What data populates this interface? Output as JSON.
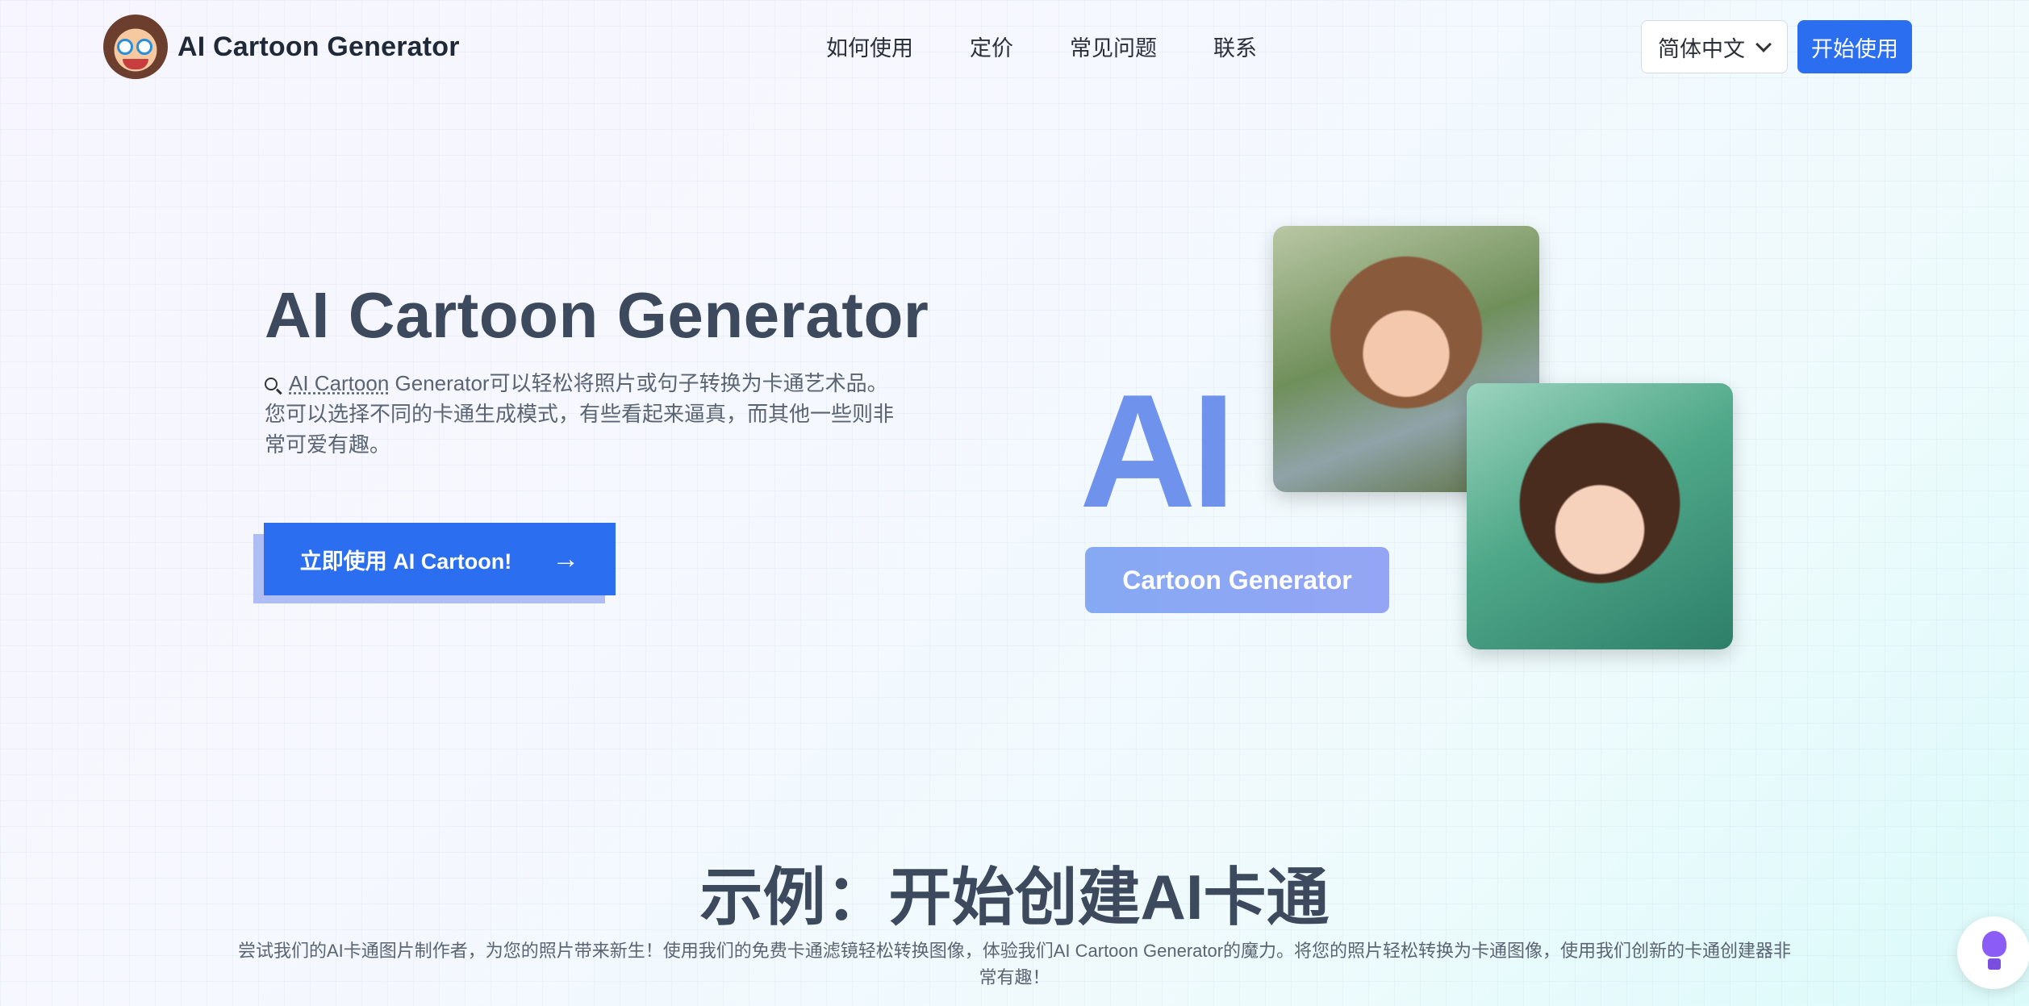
{
  "header": {
    "brand_name": "AI Cartoon Generator",
    "nav": [
      "如何使用",
      "定价",
      "常见问题",
      "联系"
    ],
    "language": "简体中文",
    "start_label": "开始使用"
  },
  "hero": {
    "title": "AI Cartoon Generator",
    "desc_link": "AI Cartoon",
    "desc_text": " Generator可以轻松将照片或句子转换为卡通艺术品。您可以选择不同的卡通生成模式，有些看起来逼真，而其他一些则非常可爱有趣。",
    "cta_label": "立即使用 AI Cartoon!",
    "cta_arrow": "→"
  },
  "illustration": {
    "big_text": "AI",
    "pill_text": "Cartoon Generator"
  },
  "examples": {
    "title": "示例：开始创建AI卡通",
    "desc": "尝试我们的AI卡通图片制作者，为您的照片带来新生！使用我们的免费卡通滤镜轻松转换图像，体验我们AI Cartoon Generator的魔力。将您的照片轻松转换为卡通图像，使用我们创新的卡通创建器非常有趣！"
  },
  "colors": {
    "accent": "#2b6ff0",
    "heading": "#3d4a5d",
    "ai_text": "#6f93ec"
  },
  "icons": [
    "logo-mascot-icon",
    "chevron-down-icon",
    "search-icon",
    "arrow-right-icon",
    "lightbulb-icon"
  ]
}
